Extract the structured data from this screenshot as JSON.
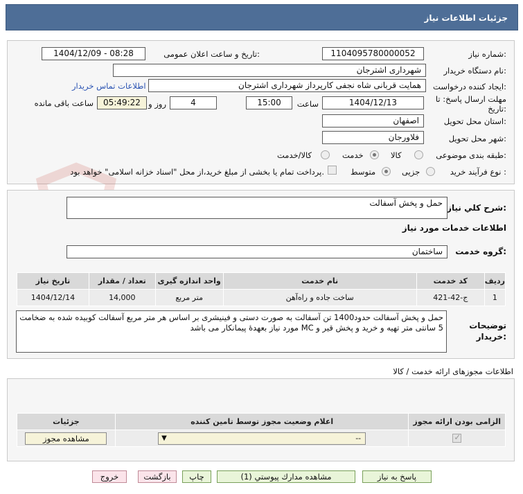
{
  "header": {
    "title": "جزئیات اطلاعات نیاز"
  },
  "fields": {
    "need_number_label": "شماره نیاز:",
    "need_number": "1104095780000052",
    "announce_label": "تاریخ و ساعت اعلان عمومی:",
    "announce_value": "1404/12/09 - 08:28",
    "buyer_org_label": "نام دستگاه خریدار:",
    "buyer_org": "شهرداری اشترجان",
    "creator_label": "ایجاد کننده درخواست:",
    "creator": "همایت قربانی شاه نجفی کارپرداز شهرداری اشترجان",
    "contact_link": "اطلاعات تماس خریدار",
    "deadline_label": "مهلت ارسال پاسخ: تا تاریخ:",
    "deadline_date": "1404/12/13",
    "time_label": "ساعت",
    "deadline_time": "15:00",
    "days_value": "4",
    "days_label": "روز و",
    "remaining_time": "05:49:22",
    "remaining_label": "ساعت باقی مانده",
    "province_label": "استان محل تحویل:",
    "province": "اصفهان",
    "city_label": "شهر محل تحویل:",
    "city": "فلاورجان",
    "category_label": "طبقه بندی موضوعی:",
    "category_options": [
      "کالا",
      "خدمت",
      "کالا/خدمت"
    ],
    "purchase_type_label": "نوع فرآیند خرید :",
    "purchase_options": [
      "جزیی",
      "متوسط"
    ],
    "payment_note": "پرداخت تمام یا بخشی از مبلغ خرید،از محل \"اسناد خزانه اسلامی\" خواهد بود."
  },
  "summary": {
    "label": "شرح کلي نياز:",
    "value": "حمل و پخش آسفالت",
    "services_heading": "اطلاعات خدمات مورد نیاز",
    "group_label": "گروه خدمت:",
    "group_value": "ساختمان"
  },
  "services_table": {
    "headers": [
      "ردیف",
      "کد خدمت",
      "نام خدمت",
      "واحد اندازه گیری",
      "تعداد / مقدار",
      "تاریخ نیاز"
    ],
    "rows": [
      [
        "1",
        "ج-42-421",
        "ساخت جاده و راه‌آهن",
        "متر مربع",
        "14,000",
        "1404/12/14"
      ]
    ]
  },
  "description": {
    "label": "توضیحات خریدار:",
    "text": "حمل و پخش آسفالت حدود1400 تن آسفالت به صورت دستی و فینیشری بر اساس هر متر مربع آسفالت کوبیده شده به ضخامت 5 سانتی متر تهیه و خرید و پخش قیر و MC مورد نیاز بعهدۀ پیمانکار می باشد"
  },
  "permits": {
    "heading": "اطلاعات مجوزهای ارائه خدمت / کالا",
    "headers": [
      "الزامی بودن ارائه مجوز",
      "اعلام وضعیت مجوز توسط تامین کننده",
      "جزئیات"
    ],
    "select_value": "--",
    "view_button": "مشاهده مجوز"
  },
  "actions": {
    "reply": "پاسخ به نیاز",
    "attachments": "مشاهده مدارك پيوستي (1)",
    "print": "چاپ",
    "back": "بازگشت",
    "exit": "خروج"
  },
  "watermark": {
    "text": "AriaTender.neT"
  },
  "colors": {
    "titlebar": "#4e6e97",
    "link": "#2a53b3",
    "watermark": "#c0392b"
  }
}
